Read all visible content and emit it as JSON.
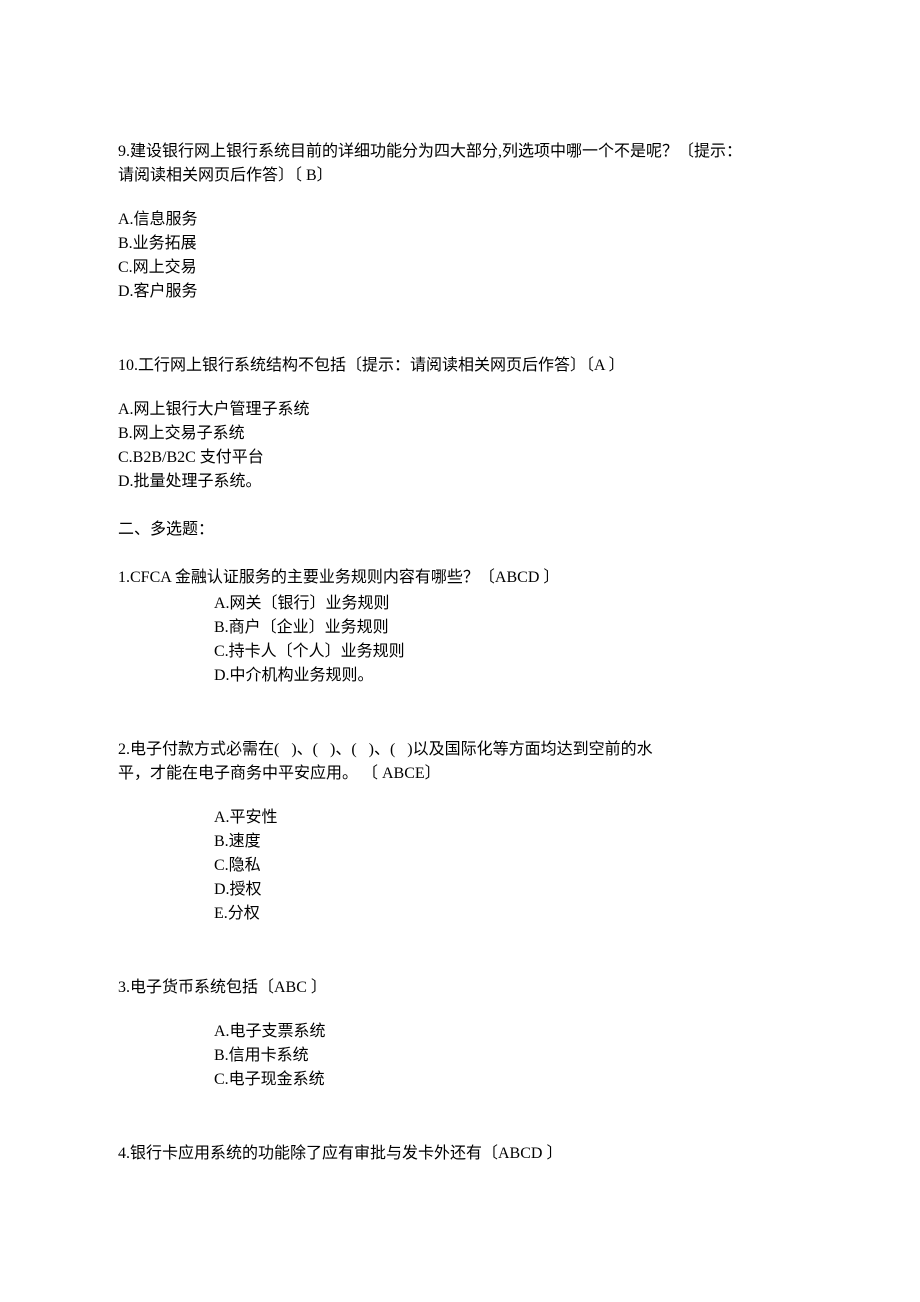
{
  "q9": {
    "stem_line1": "9.建设银行网上银行系统目前的详细功能分为四大部分,列选项中哪一个不是呢？〔提示：",
    "stem_line2": "请阅读相关网页后作答〕〔 B〕",
    "options": [
      "A.信息服务",
      "B.业务拓展",
      "C.网上交易",
      "D.客户服务"
    ]
  },
  "q10": {
    "stem": "10.工行网上银行系统结构不包括〔提示：请阅读相关网页后作答〕〔A 〕",
    "options": [
      "A.网上银行大户管理子系统",
      "B.网上交易子系统",
      "C.B2B/B2C 支付平台",
      "D.批量处理子系统。"
    ]
  },
  "section2_title": "二、多选题：",
  "mq1": {
    "stem": "1.CFCA 金融认证服务的主要业务规则内容有哪些？〔ABCD 〕",
    "options": [
      "A.网关〔银行〕业务规则",
      "B.商户〔企业〕业务规则",
      "C.持卡人〔个人〕业务规则",
      "D.中介机构业务规则。"
    ]
  },
  "mq2": {
    "stem_line1": "2.电子付款方式必需在(   )、(   )、(   )、(   )以及国际化等方面均达到空前的水",
    "stem_line2": "平，才能在电子商务中平安应用。 〔 ABCE〕",
    "options": [
      "A.平安性",
      "B.速度",
      "C.隐私",
      "D.授权",
      "E.分权"
    ]
  },
  "mq3": {
    "stem": "3.电子货币系统包括〔ABC 〕",
    "options": [
      "A.电子支票系统",
      "B.信用卡系统",
      "C.电子现金系统"
    ]
  },
  "mq4": {
    "stem": "4.银行卡应用系统的功能除了应有审批与发卡外还有〔ABCD 〕"
  }
}
